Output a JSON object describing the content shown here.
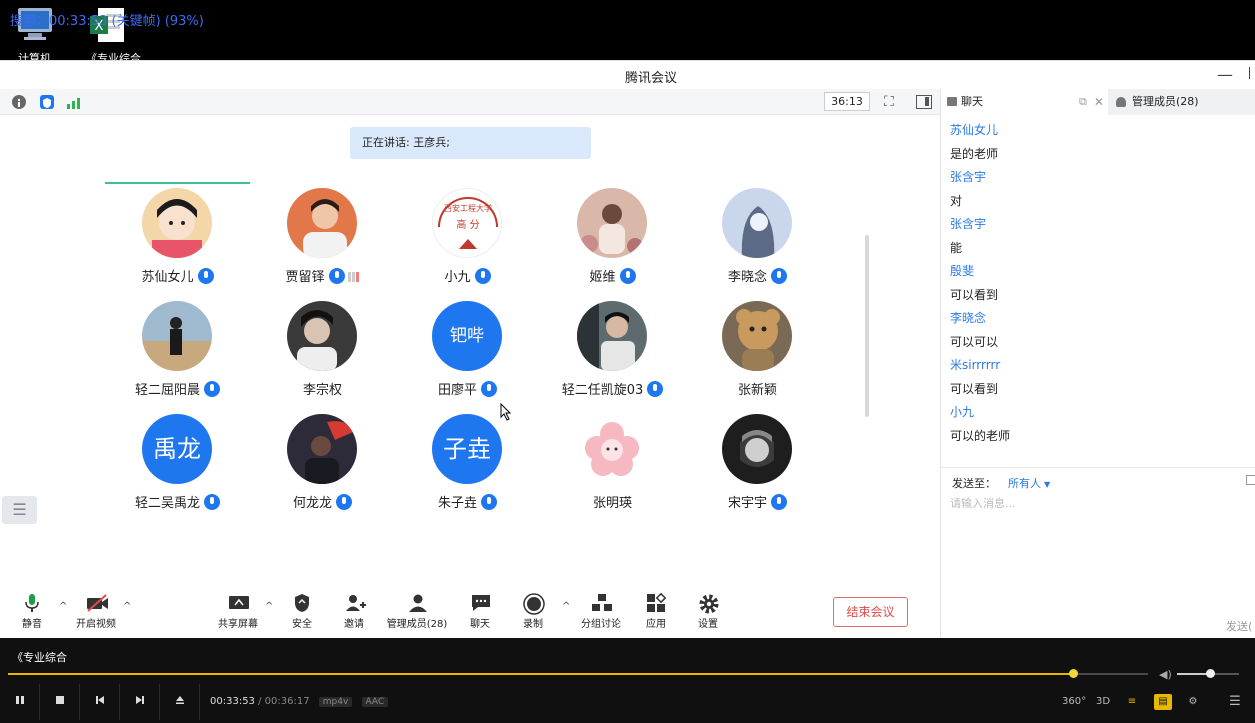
{
  "desktop": {
    "search_text": "搜索：00:33:53 (关键帧) (93%)",
    "icon1_label": "计算机",
    "icon2_label": "《专业综合"
  },
  "window": {
    "title": "腾讯会议"
  },
  "topbar": {
    "timer": "36:13"
  },
  "stage": {
    "speaking": "正在讲话: 王彦兵;",
    "participants": [
      {
        "name": "苏仙女儿",
        "mic": true,
        "avatar": "photo-baby"
      },
      {
        "name": "贾留铎",
        "mic": true,
        "signal": true,
        "avatar": "photo-man"
      },
      {
        "name": "小九",
        "mic": true,
        "avatar": "logo-xian"
      },
      {
        "name": "姬维",
        "mic": true,
        "avatar": "photo-flowers"
      },
      {
        "name": "李晓念",
        "mic": true,
        "avatar": "photo-anime"
      },
      {
        "name": "轻二屈阳晨",
        "mic": true,
        "avatar": "photo-beach"
      },
      {
        "name": "李宗权",
        "mic": false,
        "avatar": "photo-dark"
      },
      {
        "name": "田廖平",
        "mic": true,
        "avatar_text": "钯哔"
      },
      {
        "name": "轻二任凯旋03",
        "mic": true,
        "avatar": "photo-car"
      },
      {
        "name": "张新颖",
        "mic": false,
        "avatar": "photo-bear"
      },
      {
        "name": "轻二吴禹龙",
        "mic": true,
        "avatar_text": "禹龙"
      },
      {
        "name": "何龙龙",
        "mic": true,
        "avatar": "photo-flag"
      },
      {
        "name": "朱子垚",
        "mic": true,
        "avatar_text": "子垚"
      },
      {
        "name": "张明瑛",
        "mic": false,
        "avatar": "photo-cherry"
      },
      {
        "name": "宋宇宇",
        "mic": true,
        "avatar": "photo-sketch"
      }
    ],
    "xian_logo_top": "西安工程大学",
    "xian_logo_mid": "高 分"
  },
  "toolbar": {
    "mute": "静音",
    "video": "开启视频",
    "share": "共享屏幕",
    "security": "安全",
    "invite": "邀请",
    "members": "管理成员(28)",
    "chat": "聊天",
    "record": "录制",
    "breakout": "分组讨论",
    "apps": "应用",
    "settings": "设置",
    "end": "结束会议"
  },
  "panel": {
    "tab_chat": "聊天",
    "tab_members": "管理成员(28)",
    "messages": [
      {
        "from": "苏仙女儿",
        "text": "是的老师"
      },
      {
        "from": "张含宇",
        "text": "对"
      },
      {
        "from": "张含宇",
        "text": "能"
      },
      {
        "from": "殷斐",
        "text": "可以看到"
      },
      {
        "from": "李晓念",
        "text": "可以可以"
      },
      {
        "from": "米sirrrrrr",
        "text": "可以看到"
      },
      {
        "from": "小九",
        "text": "可以的老师"
      }
    ],
    "send_to_label": "发送至：",
    "send_to_value": "所有人",
    "input_placeholder": "请输入消息...",
    "send_button": "发送("
  },
  "player": {
    "title": "《专业综合",
    "current": "00:33:53",
    "duration": "/ 00:36:17",
    "format": "mp4v",
    "audio": "AAC",
    "progress_fraction": 0.934,
    "volume_fraction": 0.53,
    "btn_360": "360°",
    "btn_3d": "3D"
  },
  "colors": {
    "accent": "#1f77f0",
    "link": "#2a7ae2",
    "end": "#e04a4a",
    "progress": "#e6b800"
  }
}
